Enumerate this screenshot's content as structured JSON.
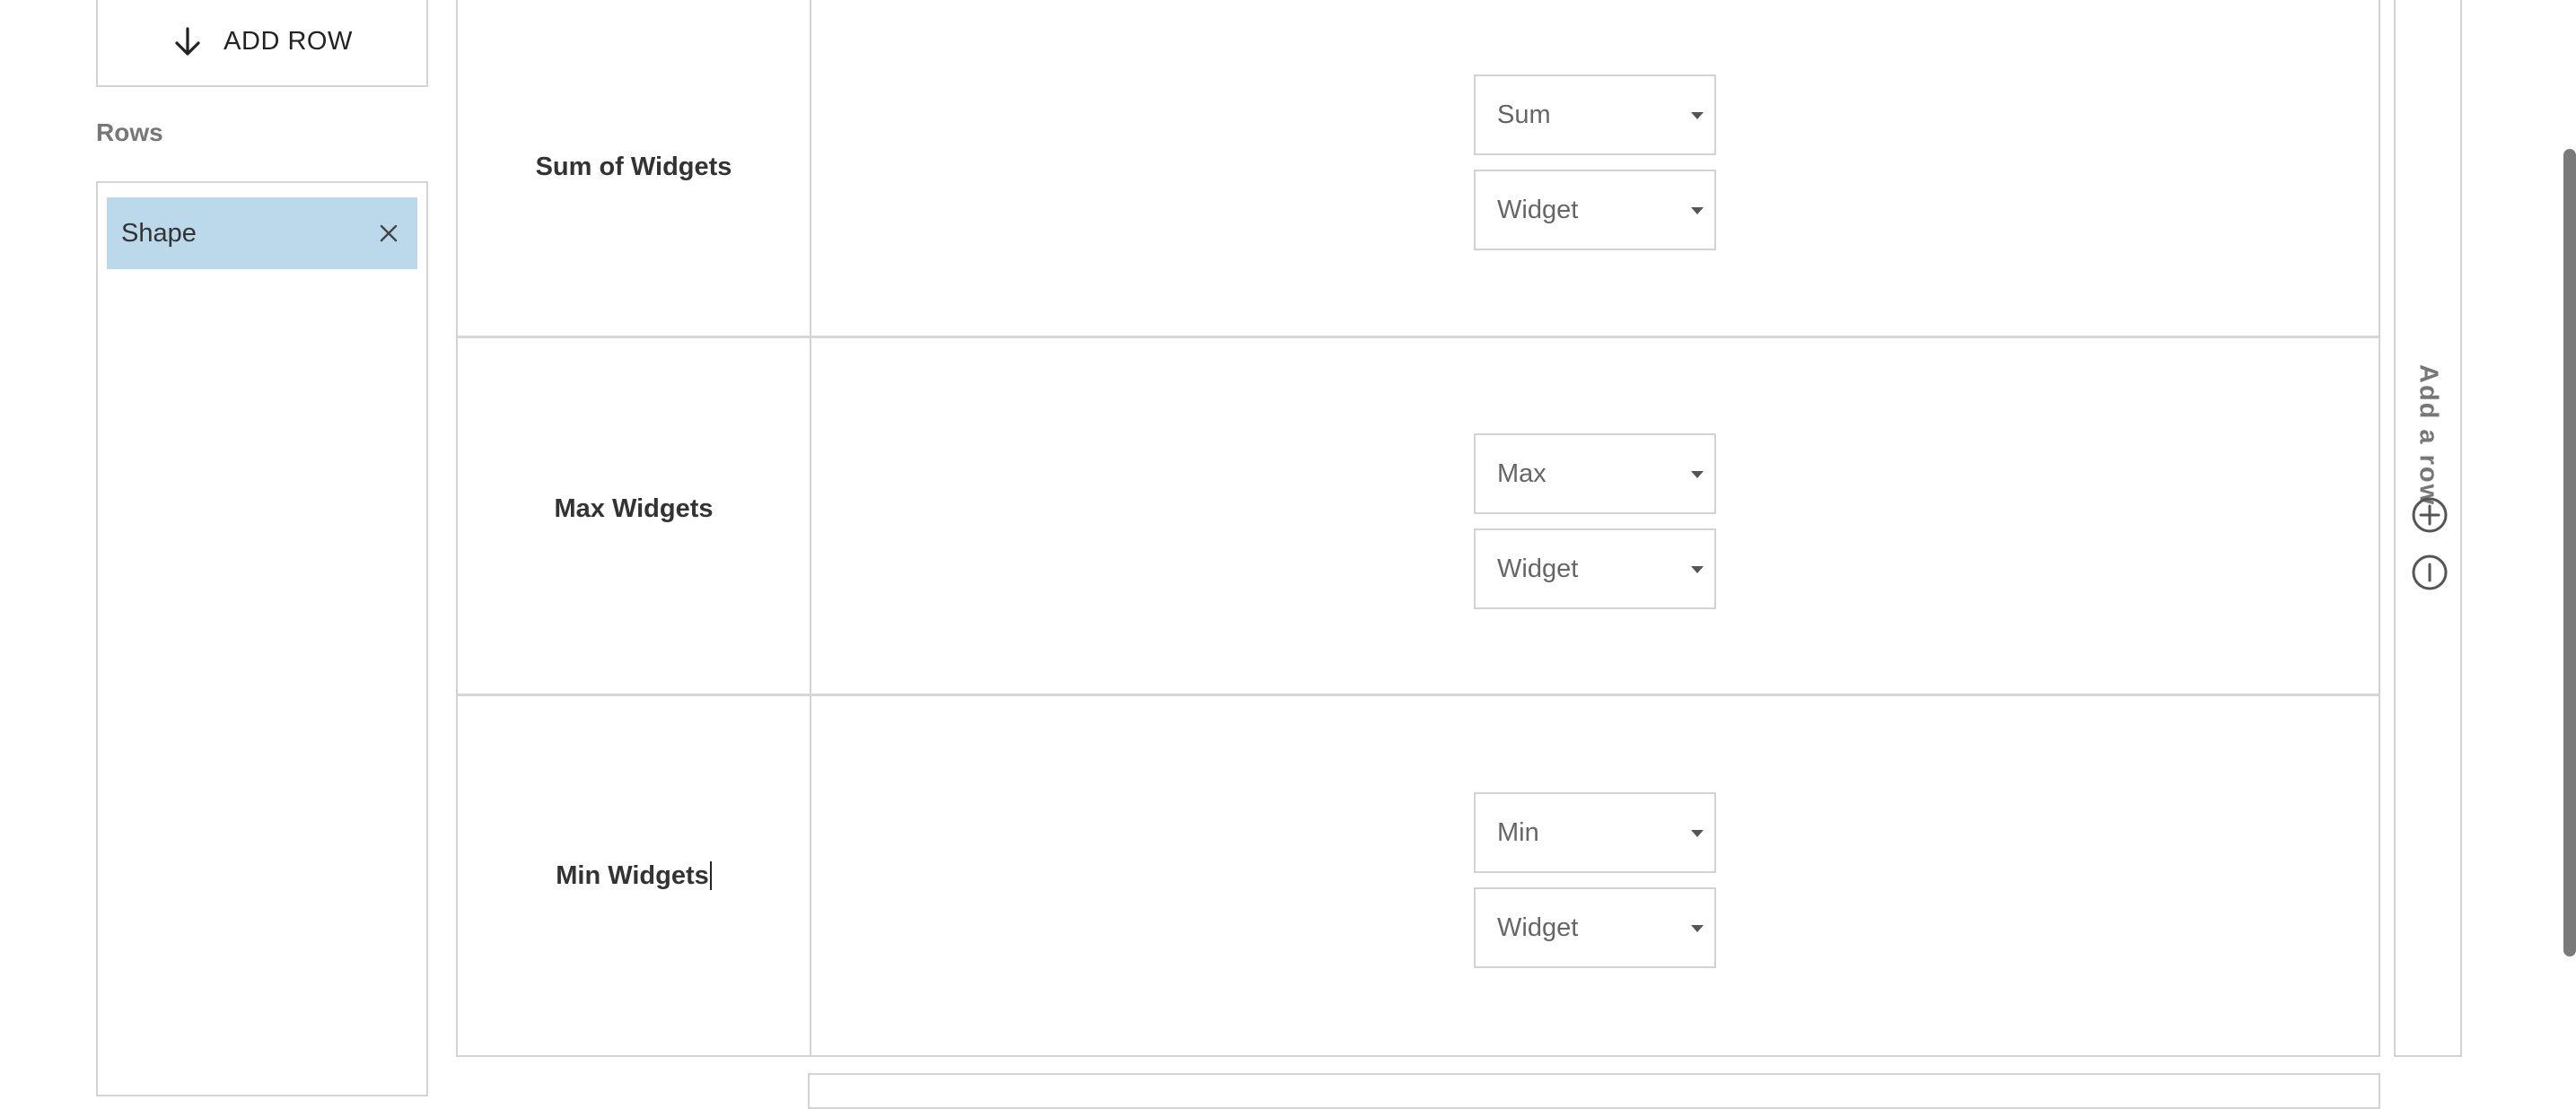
{
  "left_panel": {
    "add_row_label": "ADD ROW",
    "rows_heading": "Rows",
    "row_chips": [
      {
        "label": "Shape"
      }
    ]
  },
  "table": {
    "rows": [
      {
        "label": "Sum of Widgets",
        "aggregate": "Sum",
        "field": "Widget"
      },
      {
        "label": "Max Widgets",
        "aggregate": "Max",
        "field": "Widget"
      },
      {
        "label": "Min Widgets",
        "aggregate": "Min",
        "field": "Widget"
      }
    ]
  },
  "right_rail": {
    "label": "Add a row",
    "icons": [
      "plus-circle-icon",
      "minus-circle-icon"
    ]
  }
}
